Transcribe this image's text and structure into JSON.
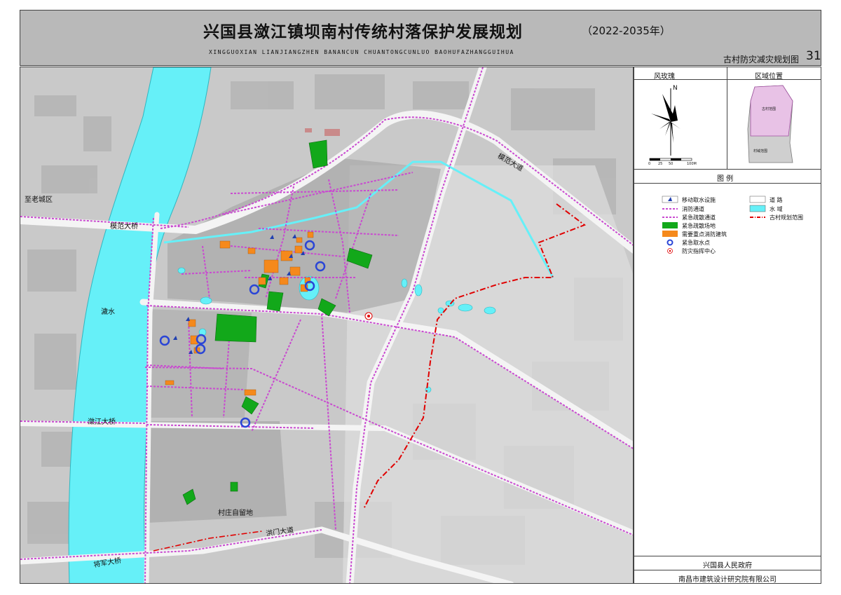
{
  "header": {
    "title": "兴国县潋江镇坝南村传统村落保护发展规划",
    "years": "（2022-2035年）",
    "pinyin": "XINGGUOXIAN LIANJIANGZHEN BANANCUN CHUANTONGCUNLUO BAOHUFAZHANGGUIHUA",
    "sheet_name": "古村防灾减灾规划图",
    "sheet_number": "31"
  },
  "sidebar": {
    "compass_title": "风玫瑰",
    "north_label": "N",
    "scale_ticks": [
      "0",
      "25",
      "50",
      "100M"
    ],
    "location_title": "区域位置",
    "location_labels": {
      "village": "古村范围",
      "remaining": "村域范围"
    },
    "legend_title": "图    例",
    "legend_items": [
      {
        "key": "mobile-water",
        "label": "移动取水设施"
      },
      {
        "key": "road",
        "label": "道    路"
      },
      {
        "key": "fire-road",
        "label": "消防通道"
      },
      {
        "key": "water",
        "label": "水    域"
      },
      {
        "key": "evac-road",
        "label": "紧急疏散通道"
      },
      {
        "key": "boundary",
        "label": "古村规划范围"
      },
      {
        "key": "evac-site",
        "label": "紧急疏散场地"
      },
      {
        "key": "key-building",
        "label": "需要重点消防建筑"
      },
      {
        "key": "water-point",
        "label": "紧急取水点"
      },
      {
        "key": "command",
        "label": "防灾指挥中心"
      }
    ],
    "government": "兴国县人民政府",
    "institute": "南昌市建筑设计研究院有限公司"
  },
  "map_labels": {
    "to_old_town": "至老城区",
    "river": "濊水",
    "mofan_bridge": "模范大桥",
    "mofan_avenue": "模范大道",
    "lianjiang_bridge": "潋江大桥",
    "jiangjun_bridge": "将军大桥",
    "hongmen_avenue": "洪门大道",
    "reserve_land": "村庄自留地"
  },
  "colors": {
    "frame": "#444444",
    "header_bg": "#b9b9b9",
    "map_bg": "#c9c9c9",
    "river": "#66f0f8",
    "evac_site": "#12a81a",
    "key_building": "#f5891c",
    "fire_road": "#c94ad0",
    "boundary": "#e00000",
    "water_point": "#2a45d6",
    "mobile_water": "#1f3fb0",
    "location_village": "#e8c2e6",
    "location_remaining": "#cfcfcf"
  }
}
